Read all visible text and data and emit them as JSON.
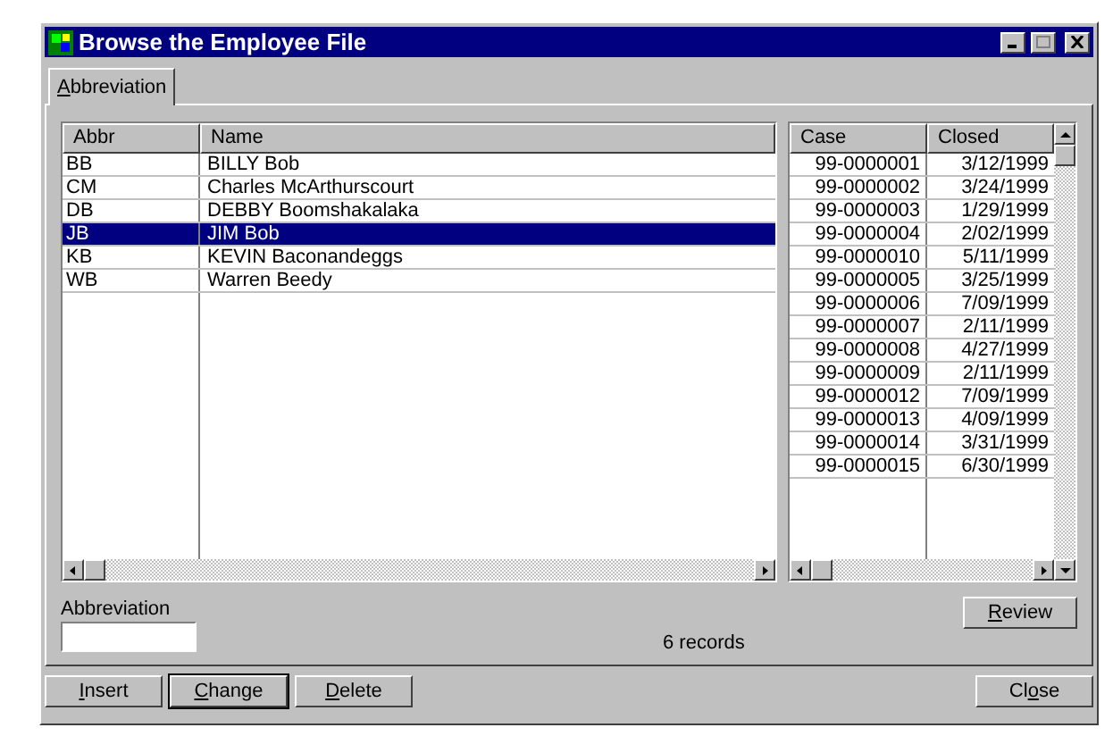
{
  "window": {
    "title": "Browse the Employee File"
  },
  "tabs": [
    {
      "label": {
        "key": "A",
        "rest": "bbreviation"
      },
      "selected": true
    }
  ],
  "employees": {
    "columns": [
      "Abbr",
      "Name"
    ],
    "rows": [
      {
        "cells": [
          "BB",
          "BILLY Bob"
        ],
        "selected": false
      },
      {
        "cells": [
          "CM",
          "Charles McArthurscourt"
        ],
        "selected": false
      },
      {
        "cells": [
          "DB",
          "DEBBY Boomshakalaka"
        ],
        "selected": false
      },
      {
        "cells": [
          "JB",
          "JIM Bob"
        ],
        "selected": true
      },
      {
        "cells": [
          "KB",
          "KEVIN Baconandeggs"
        ],
        "selected": false
      },
      {
        "cells": [
          "WB",
          "Warren Beedy"
        ],
        "selected": false
      }
    ]
  },
  "cases": {
    "columns": [
      "Case",
      "Closed"
    ],
    "rows": [
      [
        "99-0000001",
        "3/12/1999"
      ],
      [
        "99-0000002",
        "3/24/1999"
      ],
      [
        "99-0000003",
        "1/29/1999"
      ],
      [
        "99-0000004",
        "2/02/1999"
      ],
      [
        "99-0000010",
        "5/11/1999"
      ],
      [
        "99-0000005",
        "3/25/1999"
      ],
      [
        "99-0000006",
        "7/09/1999"
      ],
      [
        "99-0000007",
        "2/11/1999"
      ],
      [
        "99-0000008",
        "4/27/1999"
      ],
      [
        "99-0000009",
        "2/11/1999"
      ],
      [
        "99-0000012",
        "7/09/1999"
      ],
      [
        "99-0000013",
        "4/09/1999"
      ],
      [
        "99-0000014",
        "3/31/1999"
      ],
      [
        "99-0000015",
        "6/30/1999"
      ]
    ]
  },
  "abbreviation_field": {
    "label": "Abbreviation"
  },
  "record_count": "6 records",
  "review_button": {
    "label": {
      "key": "R",
      "rest": "eview"
    }
  },
  "buttons": [
    {
      "label": {
        "key": "I",
        "rest": "nsert"
      },
      "default": false
    },
    {
      "label": {
        "key": "C",
        "rest": "hange"
      },
      "default": true
    },
    {
      "label": {
        "key": "D",
        "rest": "elete"
      },
      "default": false
    }
  ],
  "close_button": {
    "label": {
      "before": "Cl",
      "key": "o",
      "rest": "se"
    }
  }
}
